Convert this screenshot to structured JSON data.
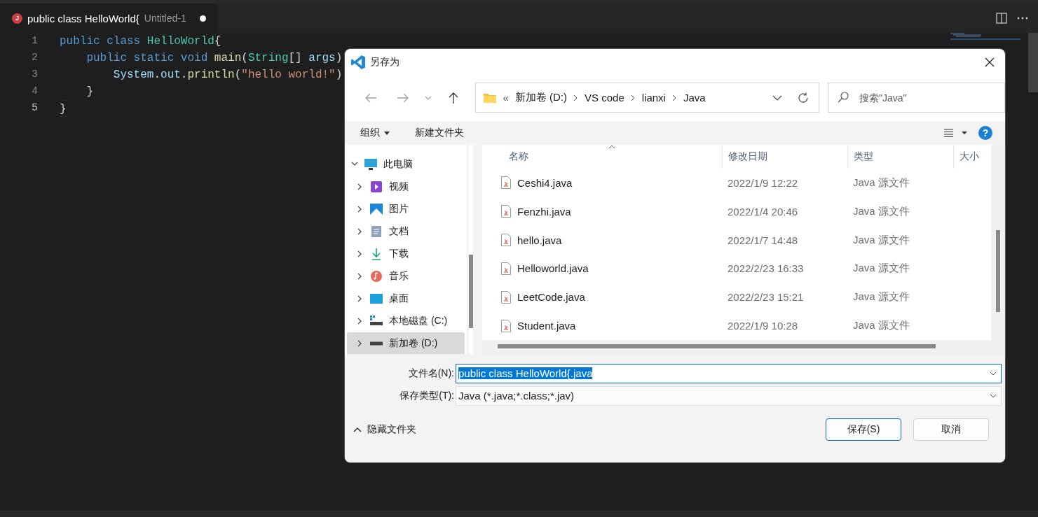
{
  "editor_tab": {
    "icon_letter": "J",
    "title": "public class HelloWorld{",
    "description": "Untitled-1",
    "modified": true
  },
  "code_lines": [
    {
      "number": "1",
      "current": false,
      "segments": [
        {
          "text": "public",
          "kind": "kw"
        },
        {
          "text": " class",
          "kind": "kw"
        },
        {
          "text": " HelloWorld",
          "kind": "type"
        },
        {
          "text": "{",
          "kind": "plain"
        }
      ]
    },
    {
      "number": "2",
      "current": false,
      "segments": [
        {
          "text": "    public",
          "kind": "kw"
        },
        {
          "text": " static",
          "kind": "kw"
        },
        {
          "text": " void",
          "kind": "kw"
        },
        {
          "text": " main",
          "kind": "fn"
        },
        {
          "text": "(",
          "kind": "plain"
        },
        {
          "text": "String",
          "kind": "type"
        },
        {
          "text": "[] ",
          "kind": "plain"
        },
        {
          "text": "args",
          "kind": "var"
        },
        {
          "text": ")",
          "kind": "plain"
        }
      ]
    },
    {
      "number": "3",
      "current": false,
      "segments": [
        {
          "text": "        System",
          "kind": "var"
        },
        {
          "text": ".",
          "kind": "plain"
        },
        {
          "text": "out",
          "kind": "var"
        },
        {
          "text": ".",
          "kind": "plain"
        },
        {
          "text": "println",
          "kind": "fn"
        },
        {
          "text": "(",
          "kind": "plain"
        },
        {
          "text": "\"hello world!\"",
          "kind": "str"
        },
        {
          "text": ")",
          "kind": "plain"
        }
      ]
    },
    {
      "number": "4",
      "current": false,
      "segments": [
        {
          "text": "    }",
          "kind": "plain"
        }
      ]
    },
    {
      "number": "5",
      "current": true,
      "segments": [
        {
          "text": "}",
          "kind": "plain"
        }
      ]
    }
  ],
  "dialog": {
    "title": "另存为",
    "address": {
      "overflow": "«",
      "crumbs": [
        "新加卷 (D:)",
        "VS code",
        "lianxi",
        "Java"
      ]
    },
    "search": {
      "placeholder": "搜索\"Java\""
    },
    "toolbar": {
      "organize": "组织",
      "new_folder": "新建文件夹",
      "help": "?"
    },
    "tree": [
      {
        "label": "此电脑",
        "kind": "pc",
        "expanded": true,
        "selected": false,
        "children": [
          {
            "label": "视频",
            "kind": "video",
            "expanded": false,
            "selected": false
          },
          {
            "label": "图片",
            "kind": "pictures",
            "expanded": false,
            "selected": false
          },
          {
            "label": "文档",
            "kind": "documents",
            "expanded": false,
            "selected": false
          },
          {
            "label": "下载",
            "kind": "downloads",
            "expanded": false,
            "selected": false
          },
          {
            "label": "音乐",
            "kind": "music",
            "expanded": false,
            "selected": false
          },
          {
            "label": "桌面",
            "kind": "desktop",
            "expanded": false,
            "selected": false
          },
          {
            "label": "本地磁盘 (C:)",
            "kind": "system-drive",
            "expanded": false,
            "selected": false
          },
          {
            "label": "新加卷 (D:)",
            "kind": "drive",
            "expanded": false,
            "selected": true
          }
        ]
      }
    ],
    "columns": [
      "名称",
      "修改日期",
      "类型",
      "大小"
    ],
    "files": [
      {
        "name": "Ceshi4.java",
        "modified": "2022/1/9 12:22",
        "type": "Java 源文件"
      },
      {
        "name": "Fenzhi.java",
        "modified": "2022/1/4 20:46",
        "type": "Java 源文件"
      },
      {
        "name": "hello.java",
        "modified": "2022/1/7 14:48",
        "type": "Java 源文件"
      },
      {
        "name": "Helloworld.java",
        "modified": "2022/2/23 16:33",
        "type": "Java 源文件"
      },
      {
        "name": "LeetCode.java",
        "modified": "2022/2/23 15:21",
        "type": "Java 源文件"
      },
      {
        "name": "Student.java",
        "modified": "2022/1/9 10:28",
        "type": "Java 源文件"
      }
    ],
    "filename": {
      "label": "文件名(N):",
      "value": "public class HelloWorld{.java"
    },
    "filetype": {
      "label": "保存类型(T):",
      "value": "Java (*.java;*.class;*.jav)"
    },
    "hide_folders": "隐藏文件夹",
    "buttons": [
      {
        "label": "保存(S)",
        "primary": true
      },
      {
        "label": "取消",
        "primary": false
      }
    ]
  }
}
